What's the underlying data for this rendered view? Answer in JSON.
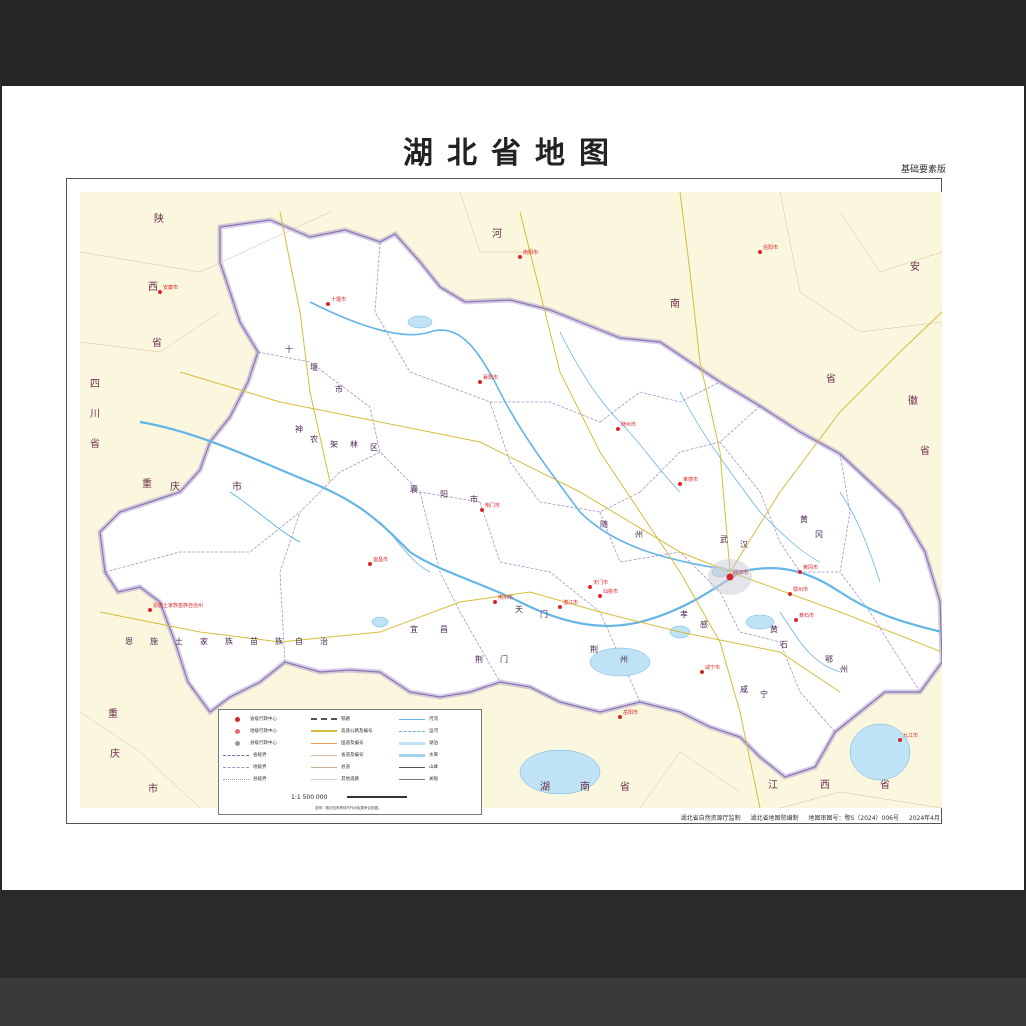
{
  "map": {
    "title": "湖北省地图",
    "edition": "基础要素版",
    "footer": {
      "supervisor": "湖北省自然资源厅监制",
      "compiler": "湖北省地图院编制",
      "approval": "地图审图号：鄂S（2024）006号",
      "date": "2024年4月"
    },
    "scale": "1:1 500 000",
    "scale_note": "说明：图示四岸界线不作为权属争议依据。",
    "colors": {
      "province_fill": "#ffffff",
      "outside_fill": "#fbf7df",
      "province_border": "#8a74b8",
      "river": "#66b5e6",
      "lake": "#bfe3f5",
      "city": "#d9252a",
      "highway": "#d6bd3c"
    }
  },
  "region_labels": [
    {
      "text": "陕",
      "name": "region-label-shaanxi"
    },
    {
      "text": "西",
      "name": "region-label-shaanxi-2"
    },
    {
      "text": "省",
      "name": "region-label-shaanxi-3"
    },
    {
      "text": "河",
      "name": "region-label-henan"
    },
    {
      "text": "南",
      "name": "region-label-henan-2"
    },
    {
      "text": "省",
      "name": "region-label-henan-3"
    },
    {
      "text": "安",
      "name": "region-label-anhui"
    },
    {
      "text": "省",
      "name": "region-label-anhui-2"
    },
    {
      "text": "徽",
      "name": "region-label-anhui-3"
    },
    {
      "text": "四",
      "name": "region-label-sichuan"
    },
    {
      "text": "川",
      "name": "region-label-sichuan-2"
    },
    {
      "text": "省",
      "name": "region-label-sichuan-3"
    },
    {
      "text": "重",
      "name": "region-label-chongqing"
    },
    {
      "text": "庆",
      "name": "region-label-chongqing-2"
    },
    {
      "text": "市",
      "name": "region-label-chongqing-3"
    },
    {
      "text": "湖",
      "name": "region-label-hunan"
    },
    {
      "text": "南",
      "name": "region-label-hunan-2"
    },
    {
      "text": "省",
      "name": "region-label-hunan-3"
    },
    {
      "text": "江",
      "name": "region-label-jiangxi"
    },
    {
      "text": "西",
      "name": "region-label-jiangxi-2"
    },
    {
      "text": "省",
      "name": "region-label-jiangxi-3"
    },
    {
      "text": "重",
      "name": "region-label-chongqing-s"
    },
    {
      "text": "庆",
      "name": "region-label-chongqing-s2"
    },
    {
      "text": "市",
      "name": "region-label-chongqing-s3"
    }
  ],
  "prefecture_labels": [
    "十",
    "堰",
    "市",
    "襄",
    "阳",
    "市",
    "随",
    "州",
    "孝",
    "感",
    "宜",
    "昌",
    "荆",
    "门",
    "天",
    "门",
    "荆",
    "州",
    "武",
    "汉",
    "黄",
    "冈",
    "咸",
    "宁",
    "鄂",
    "州",
    "黄",
    "石",
    "神",
    "农",
    "架",
    "林",
    "区",
    "恩",
    "施",
    "土",
    "家",
    "族",
    "苗",
    "族",
    "自",
    "治",
    "州"
  ],
  "cities": [
    {
      "name": "十堰市",
      "key": "shiyan"
    },
    {
      "name": "襄阳市",
      "key": "xiangyang"
    },
    {
      "name": "随州市",
      "key": "suizhou"
    },
    {
      "name": "荆门市",
      "key": "jingmen"
    },
    {
      "name": "孝感市",
      "key": "xiaogan"
    },
    {
      "name": "宜昌市",
      "key": "yichang"
    },
    {
      "name": "荆州市",
      "key": "jingzhou"
    },
    {
      "name": "武汉市",
      "key": "wuhan"
    },
    {
      "name": "鄂州市",
      "key": "ezhou"
    },
    {
      "name": "黄冈市",
      "key": "huanggang"
    },
    {
      "name": "黄石市",
      "key": "huangshi"
    },
    {
      "name": "咸宁市",
      "key": "xianning"
    },
    {
      "name": "仙桃市",
      "key": "xiantao"
    },
    {
      "name": "潜江市",
      "key": "qianjiang"
    },
    {
      "name": "天门市",
      "key": "tianmen"
    },
    {
      "name": "恩施土家族苗族自治州",
      "key": "enshi"
    },
    {
      "name": "岳阳市",
      "key": "yueyang"
    },
    {
      "name": "九江市",
      "key": "jiujiang"
    },
    {
      "name": "南阳市",
      "key": "nanyang"
    },
    {
      "name": "信阳市",
      "key": "xinyang"
    },
    {
      "name": "安康市",
      "key": "ankang"
    }
  ],
  "legend": {
    "items": [
      {
        "label": "省级行政中心"
      },
      {
        "label": "地级行政中心"
      },
      {
        "label": "县级行政中心"
      },
      {
        "label": "省级界"
      },
      {
        "label": "地级界"
      },
      {
        "label": "县级界"
      },
      {
        "label": "铁路"
      },
      {
        "label": "高速公路及编号"
      },
      {
        "label": "国道及编号"
      },
      {
        "label": "省道及编号"
      },
      {
        "label": "县道"
      },
      {
        "label": "其他道路"
      },
      {
        "label": "河流"
      },
      {
        "label": "运河"
      },
      {
        "label": "湖泊"
      },
      {
        "label": "水库"
      },
      {
        "label": "山峰"
      },
      {
        "label": "关隘"
      }
    ]
  }
}
